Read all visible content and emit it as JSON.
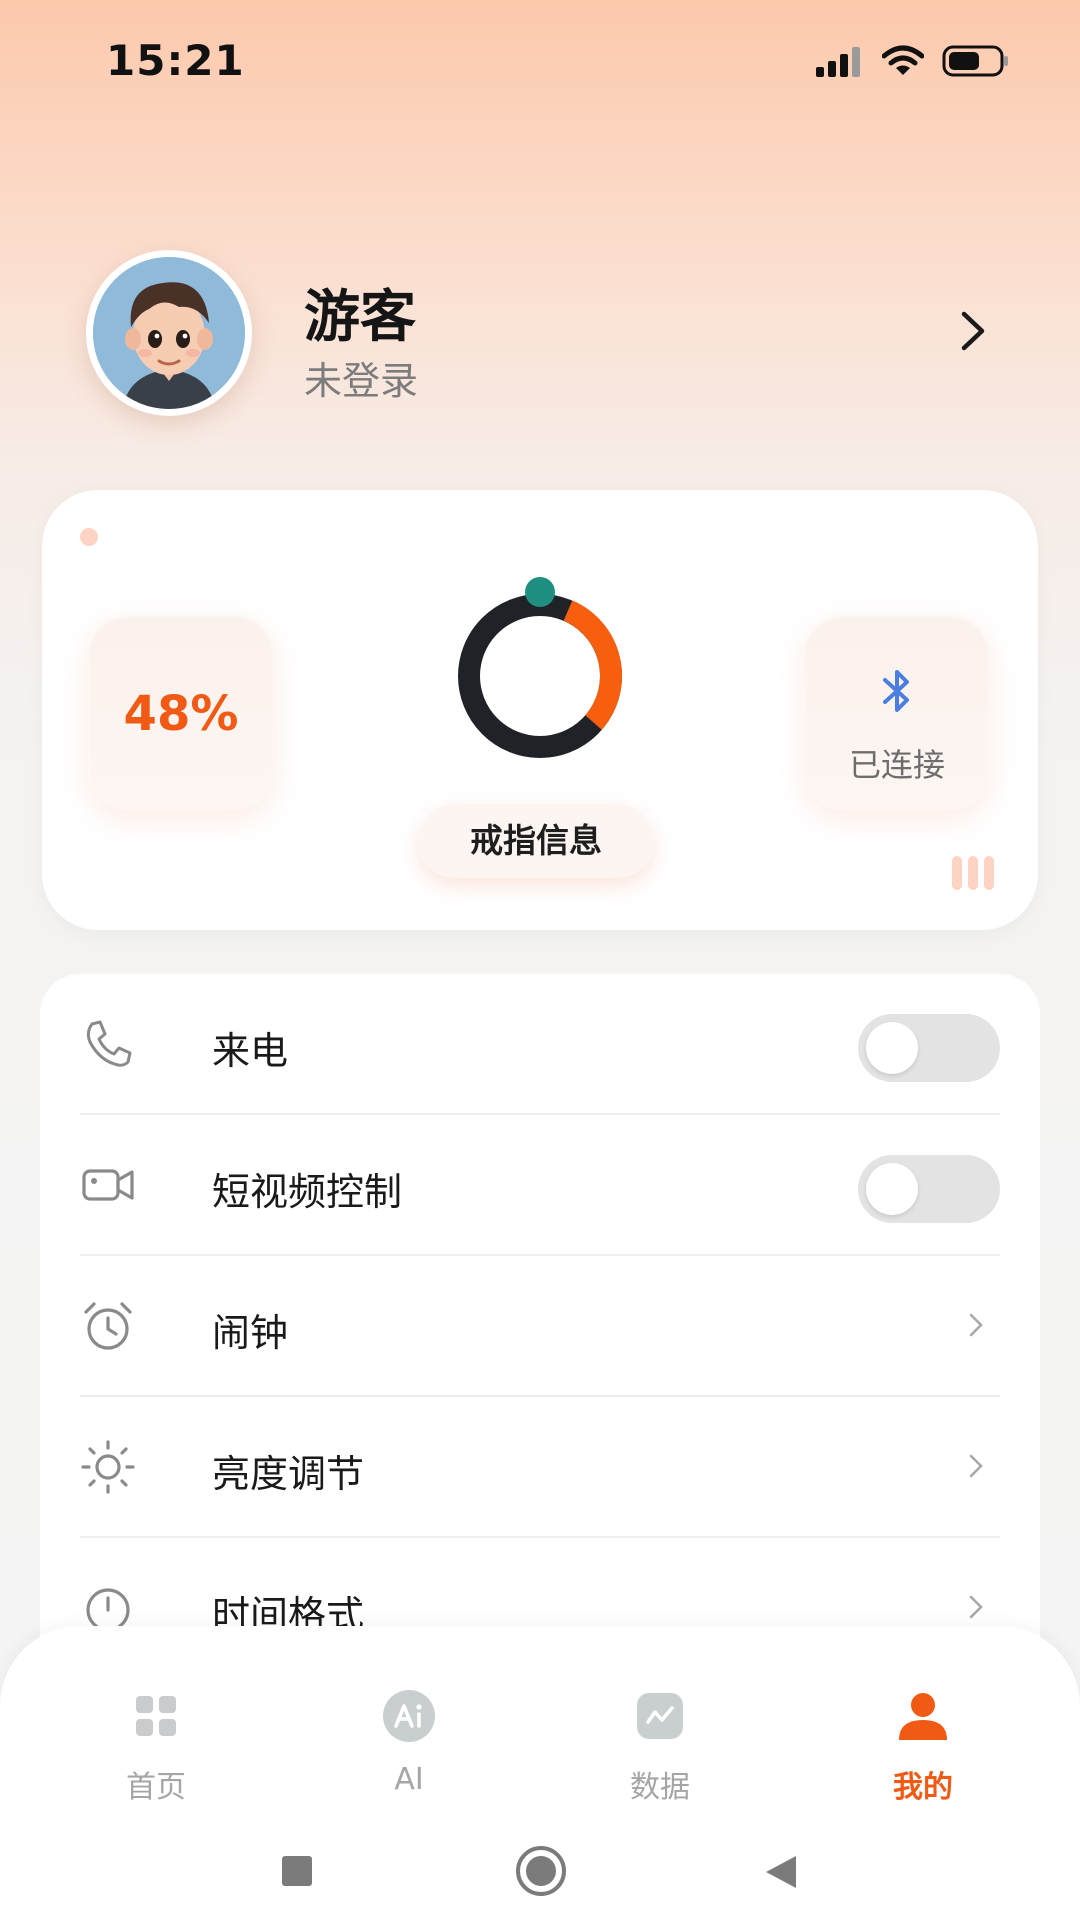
{
  "status_bar": {
    "time": "15:21"
  },
  "profile": {
    "name": "游客",
    "status": "未登录"
  },
  "ring_card": {
    "battery": "48%",
    "bluetooth_status": "已连接",
    "info_button": "戒指信息"
  },
  "settings": [
    {
      "label": "来电",
      "icon": "phone-icon",
      "control": "toggle",
      "on": false
    },
    {
      "label": "短视频控制",
      "icon": "video-icon",
      "control": "toggle",
      "on": false
    },
    {
      "label": "闹钟",
      "icon": "alarm-icon",
      "control": "chevron"
    },
    {
      "label": "亮度调节",
      "icon": "brightness-icon",
      "control": "chevron"
    },
    {
      "label": "时间格式",
      "icon": "clock-icon",
      "control": "chevron"
    }
  ],
  "nav": [
    {
      "label": "首页",
      "icon": "home-grid-icon",
      "active": false
    },
    {
      "label": "AI",
      "icon": "ai-icon",
      "active": false
    },
    {
      "label": "数据",
      "icon": "data-chart-icon",
      "active": false
    },
    {
      "label": "我的",
      "icon": "profile-icon",
      "active": true
    }
  ],
  "colors": {
    "accent": "#f05a14",
    "ring_dark": "#1f2327",
    "ring_marker": "#1e8f80",
    "bluetooth": "#4a7fe0"
  }
}
